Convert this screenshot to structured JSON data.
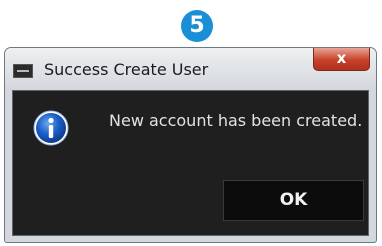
{
  "step_badge": "5",
  "dialog": {
    "title": "Success Create User",
    "close_label": "x",
    "message": "New account has been created.",
    "ok_label": "OK",
    "icons": {
      "app": "app-icon",
      "info": "info-icon"
    }
  },
  "colors": {
    "badge": "#1a8fd6",
    "close_button": "#c7412a",
    "content_background": "#1f1f1f",
    "info_icon": "#1b5fc8"
  }
}
